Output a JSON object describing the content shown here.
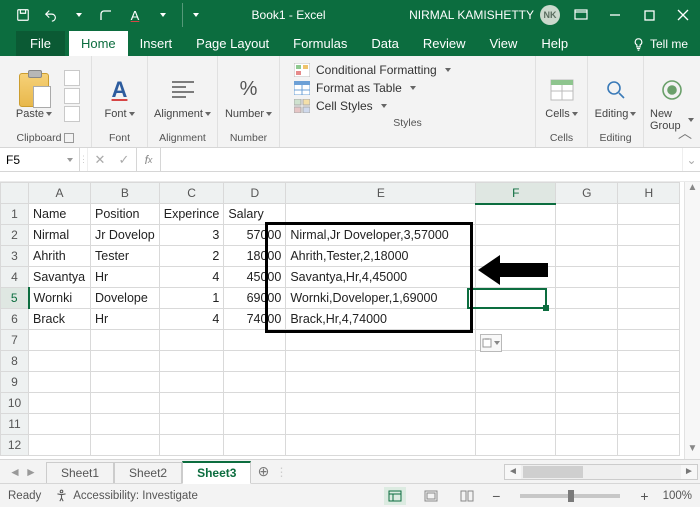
{
  "titlebar": {
    "title": "Book1 - Excel",
    "user_name": "NIRMAL KAMISHETTY",
    "user_initials": "NK"
  },
  "tabs": {
    "file": "File",
    "items": [
      "Home",
      "Insert",
      "Page Layout",
      "Formulas",
      "Data",
      "Review",
      "View",
      "Help"
    ],
    "active": "Home",
    "tellme": "Tell me"
  },
  "ribbon": {
    "clipboard": {
      "label": "Clipboard",
      "paste": "Paste"
    },
    "font": {
      "label": "Font",
      "btn": "Font"
    },
    "alignment": {
      "label": "Alignment",
      "btn": "Alignment"
    },
    "number": {
      "label": "Number",
      "btn": "Number"
    },
    "styles": {
      "label": "Styles",
      "cond_fmt": "Conditional Formatting",
      "fmt_table": "Format as Table",
      "cell_styles": "Cell Styles"
    },
    "cells": {
      "label": "Cells",
      "btn": "Cells"
    },
    "editing": {
      "label": "Editing",
      "btn": "Editing"
    },
    "newgroup": {
      "label": "",
      "btn": "New Group"
    }
  },
  "namebox": "F5",
  "formula": "",
  "columns": [
    "A",
    "B",
    "C",
    "D",
    "E",
    "F",
    "G",
    "H"
  ],
  "rows": [
    {
      "n": 1,
      "A": "Name",
      "B": "Position",
      "C": "Experince",
      "D": "Salary",
      "E": "",
      "D_align": "left",
      "C_align": "left"
    },
    {
      "n": 2,
      "A": "Nirmal",
      "B": "Jr Dovelop",
      "C": "3",
      "D": "57000",
      "E": "Nirmal,Jr Doveloper,3,57000"
    },
    {
      "n": 3,
      "A": "Ahrith",
      "B": "Tester",
      "C": "2",
      "D": "18000",
      "E": "Ahrith,Tester,2,18000"
    },
    {
      "n": 4,
      "A": "Savantya",
      "B": "Hr",
      "C": "4",
      "D": "45000",
      "E": "Savantya,Hr,4,45000"
    },
    {
      "n": 5,
      "A": "Wornki",
      "B": "Dovelope",
      "C": "1",
      "D": "69000",
      "E": "Wornki,Doveloper,1,69000"
    },
    {
      "n": 6,
      "A": "Brack",
      "B": "Hr",
      "C": "4",
      "D": "74000",
      "E": "Brack,Hr,4,74000"
    },
    {
      "n": 7
    },
    {
      "n": 8
    },
    {
      "n": 9
    },
    {
      "n": 10
    },
    {
      "n": 11
    },
    {
      "n": 12
    }
  ],
  "selected": {
    "col": "F",
    "row": 5
  },
  "sheet_tabs": {
    "items": [
      "Sheet1",
      "Sheet2",
      "Sheet3"
    ],
    "active": "Sheet3"
  },
  "status": {
    "mode": "Ready",
    "accessibility": "Accessibility: Investigate",
    "zoom": "100%"
  }
}
